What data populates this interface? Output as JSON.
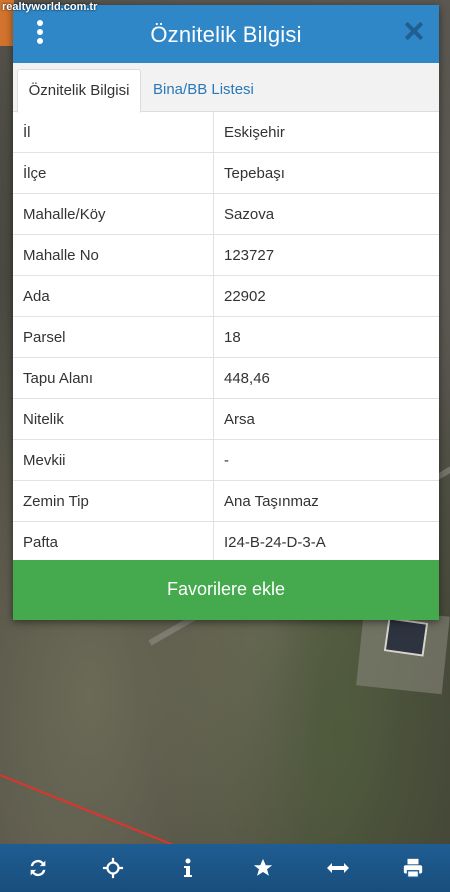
{
  "watermark": "realtyworld.com.tr",
  "dialog": {
    "title": "Öznitelik Bilgisi",
    "tabs": [
      {
        "label": "Öznitelik Bilgisi",
        "active": true
      },
      {
        "label": "Bina/BB Listesi",
        "active": false
      }
    ],
    "rows": [
      {
        "key": "İl",
        "value": "Eskişehir"
      },
      {
        "key": "İlçe",
        "value": "Tepebaşı"
      },
      {
        "key": "Mahalle/Köy",
        "value": "Sazova"
      },
      {
        "key": "Mahalle No",
        "value": "123727"
      },
      {
        "key": "Ada",
        "value": "22902"
      },
      {
        "key": "Parsel",
        "value": "18"
      },
      {
        "key": "Tapu Alanı",
        "value": "448,46"
      },
      {
        "key": "Nitelik",
        "value": "Arsa"
      },
      {
        "key": "Mevkii",
        "value": "-"
      },
      {
        "key": "Zemin Tip",
        "value": "Ana Taşınmaz"
      },
      {
        "key": "Pafta",
        "value": "I24-B-24-D-3-A"
      }
    ],
    "favorite_button": "Favorilere ekle"
  },
  "toolbar": {
    "icons": [
      "refresh-icon",
      "move-icon",
      "info-icon",
      "star-icon",
      "measure-icon",
      "print-icon"
    ]
  },
  "colors": {
    "header": "#2f87c8",
    "button": "#45a94d",
    "toolbar": "#1f5d92",
    "tab_link": "#2a78b7"
  }
}
